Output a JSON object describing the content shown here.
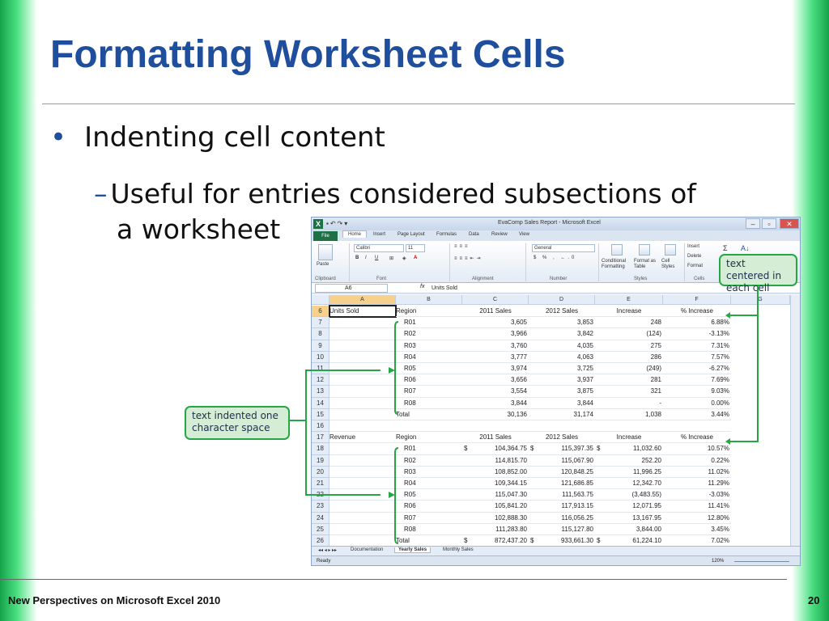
{
  "slide": {
    "title": "Formatting Worksheet Cells",
    "bullet1": "Indenting cell content",
    "bullet2_dash": "–",
    "bullet2_line1": "Useful for entries considered subsections of",
    "bullet2_line2": "a worksheet",
    "bullet_symbol": "•",
    "footer": "New Perspectives on Microsoft Excel 2010",
    "page_number": "20",
    "accent_color": "#1f4e9c",
    "side_bar_color": "#16a34a"
  },
  "excel": {
    "window_title": "EvaComp Sales Report - Microsoft Excel",
    "file_tab": "File",
    "tabs": [
      "Home",
      "Insert",
      "Page Layout",
      "Formulas",
      "Data",
      "Review",
      "View"
    ],
    "ribbon": {
      "paste": "Paste",
      "font_name": "Calibri",
      "font_size": "11",
      "number_format": "General",
      "conditional_formatting": "Conditional Formatting",
      "format_as_table": "Format as Table",
      "cell_styles": "Cell Styles",
      "insert": "Insert",
      "delete": "Delete",
      "format": "Format",
      "groups": [
        "Clipboard",
        "Font",
        "Alignment",
        "Number",
        "Styles",
        "Cells"
      ]
    },
    "name_box": "A6",
    "fx": "fx",
    "formula_value": "Units Sold",
    "columns": [
      "A",
      "B",
      "C",
      "D",
      "E",
      "F",
      "G"
    ],
    "rows": [
      {
        "num": "6",
        "a": "Units Sold",
        "b": "Region",
        "c": "2011 Sales",
        "d": "2012 Sales",
        "e": "Increase",
        "f": "% Increase",
        "header": true
      },
      {
        "num": "7",
        "a": "",
        "b": "R01",
        "c": "3,605",
        "d": "3,853",
        "e": "248",
        "f": "6.88%",
        "indent": true
      },
      {
        "num": "8",
        "a": "",
        "b": "R02",
        "c": "3,966",
        "d": "3,842",
        "e": "(124)",
        "f": "-3.13%",
        "indent": true
      },
      {
        "num": "9",
        "a": "",
        "b": "R03",
        "c": "3,760",
        "d": "4,035",
        "e": "275",
        "f": "7.31%",
        "indent": true
      },
      {
        "num": "10",
        "a": "",
        "b": "R04",
        "c": "3,777",
        "d": "4,063",
        "e": "286",
        "f": "7.57%",
        "indent": true
      },
      {
        "num": "11",
        "a": "",
        "b": "R05",
        "c": "3,974",
        "d": "3,725",
        "e": "(249)",
        "f": "-6.27%",
        "indent": true
      },
      {
        "num": "12",
        "a": "",
        "b": "R06",
        "c": "3,656",
        "d": "3,937",
        "e": "281",
        "f": "7.69%",
        "indent": true
      },
      {
        "num": "13",
        "a": "",
        "b": "R07",
        "c": "3,554",
        "d": "3,875",
        "e": "321",
        "f": "9.03%",
        "indent": true
      },
      {
        "num": "14",
        "a": "",
        "b": "R08",
        "c": "3,844",
        "d": "3,844",
        "e": "-",
        "f": "0.00%",
        "indent": true
      },
      {
        "num": "15",
        "a": "",
        "b": "Total",
        "c": "30,136",
        "d": "31,174",
        "e": "1,038",
        "f": "3.44%"
      },
      {
        "num": "16",
        "a": "",
        "b": "",
        "c": "",
        "d": "",
        "e": "",
        "f": ""
      },
      {
        "num": "17",
        "a": "Revenue",
        "b": "Region",
        "c": "2011 Sales",
        "d": "2012 Sales",
        "e": "Increase",
        "f": "% Increase",
        "header": true
      },
      {
        "num": "18",
        "a": "",
        "b": "R01",
        "c_cur": "$",
        "c": "104,364.75",
        "d_cur": "$",
        "d": "115,397.35",
        "e_cur": "$",
        "e": "11,032.60",
        "f": "10.57%",
        "indent": true
      },
      {
        "num": "19",
        "a": "",
        "b": "R02",
        "c": "114,815.70",
        "d": "115,067.90",
        "e": "252.20",
        "f": "0.22%",
        "indent": true
      },
      {
        "num": "20",
        "a": "",
        "b": "R03",
        "c": "108,852.00",
        "d": "120,848.25",
        "e": "11,996.25",
        "f": "11.02%",
        "indent": true
      },
      {
        "num": "21",
        "a": "",
        "b": "R04",
        "c": "109,344.15",
        "d": "121,686.85",
        "e": "12,342.70",
        "f": "11.29%",
        "indent": true
      },
      {
        "num": "22",
        "a": "",
        "b": "R05",
        "c": "115,047.30",
        "d": "111,563.75",
        "e": "(3,483.55)",
        "f": "-3.03%",
        "indent": true
      },
      {
        "num": "23",
        "a": "",
        "b": "R06",
        "c": "105,841.20",
        "d": "117,913.15",
        "e": "12,071.95",
        "f": "11.41%",
        "indent": true
      },
      {
        "num": "24",
        "a": "",
        "b": "R07",
        "c": "102,888.30",
        "d": "116,056.25",
        "e": "13,167.95",
        "f": "12.80%",
        "indent": true
      },
      {
        "num": "25",
        "a": "",
        "b": "R08",
        "c": "111,283.80",
        "d": "115,127.80",
        "e": "3,844.00",
        "f": "3.45%",
        "indent": true
      },
      {
        "num": "26",
        "a": "",
        "b": "Total",
        "c_cur": "$",
        "c": "872,437.20",
        "d_cur": "$",
        "d": "933,661.30",
        "e_cur": "$",
        "e": "61,224.10",
        "f": "7.02%"
      }
    ],
    "sheet_tabs": [
      "Documentation",
      "Yearly Sales",
      "Monthly Sales"
    ],
    "active_sheet": "Yearly Sales",
    "status": "Ready",
    "zoom": "120%"
  },
  "callouts": {
    "centered": "text centered in each cell",
    "indented": "text indented one character space",
    "color": "#27a645"
  }
}
